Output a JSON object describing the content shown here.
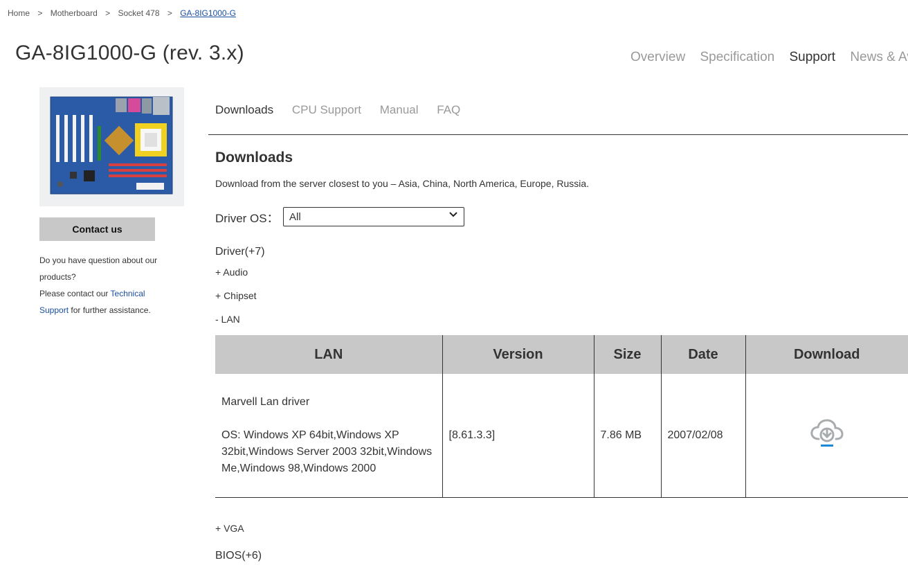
{
  "breadcrumb": {
    "items": [
      "Home",
      "Motherboard",
      "Socket 478"
    ],
    "current": "GA-8IG1000-G",
    "separator": ">"
  },
  "product": {
    "title": "GA-8IG1000-G (rev. 3.x)",
    "image_icon": "motherboard-photo"
  },
  "main_nav": [
    "Overview",
    "Specification",
    "Support",
    "News & Av"
  ],
  "sidebar": {
    "contact_label": "Contact us",
    "text_1": "Do you have question about our products?",
    "text_2": "Please contact our",
    "link": "Technical Support",
    "text_3": "for further assistance."
  },
  "sub_nav": [
    "Downloads",
    "CPU Support",
    "Manual",
    "FAQ"
  ],
  "downloads": {
    "title": "Downloads",
    "description": "Download from the server closest to you – Asia, China, North America, Europe, Russia.",
    "os_label": "Driver OS：",
    "os_value": "All"
  },
  "driver_group": {
    "title": "Driver(+7)",
    "categories": {
      "audio": "+ Audio",
      "chipset": "+ Chipset",
      "lan": "- LAN",
      "vga": "+ VGA"
    }
  },
  "table": {
    "headers": [
      "LAN",
      "Version",
      "Size",
      "Date",
      "Download"
    ],
    "rows": [
      {
        "name": "Marvell Lan driver",
        "os": "OS: Windows XP 64bit,Windows XP 32bit,Windows Server 2003 32bit,Windows Me,Windows 98,Windows 2000",
        "version": "[8.61.3.3]",
        "size": "7.86 MB",
        "date": "2007/02/08",
        "download_icon": "cloud-download-icon"
      }
    ]
  },
  "bios_group": {
    "title": "BIOS(+6)"
  },
  "colors": {
    "accent_link": "#1a4fa0",
    "header_bg": "#c8c8c8",
    "download_icon_gray": "#a8acaf",
    "download_icon_blue": "#1e88d8"
  }
}
